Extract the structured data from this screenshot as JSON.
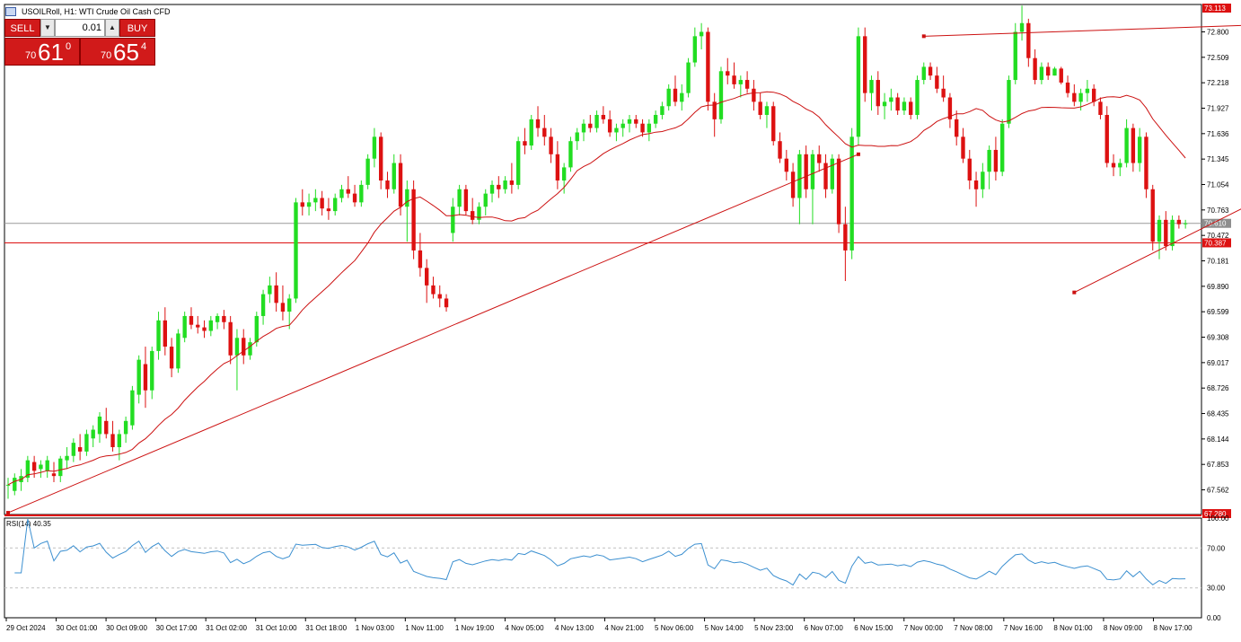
{
  "title": "USOILRoll, H1:  WTI Crude Oil Cash CFD",
  "trade_panel": {
    "sell_label": "SELL",
    "buy_label": "BUY",
    "lot": "0.01",
    "sell_price_prefix": "70",
    "sell_price_big": "61",
    "sell_price_sup": "0",
    "buy_price_prefix": "70",
    "buy_price_big": "65",
    "buy_price_sup": "4"
  },
  "price_axis_labels": [
    "72.800",
    "72.509",
    "72.218",
    "71.927",
    "71.636",
    "71.345",
    "71.054",
    "70.763",
    "70.472",
    "70.181",
    "69.890",
    "69.599",
    "69.308",
    "69.017",
    "68.726",
    "68.435",
    "68.144",
    "67.853",
    "67.562"
  ],
  "price_axis_top": "73.113",
  "price_axis_bottom": "67.280",
  "current_price": "70.610",
  "hline_price": "70.387",
  "rsi": {
    "label": "RSI(14) 40.35",
    "levels": [
      "100.00",
      "70.00",
      "30.00",
      "0.00"
    ]
  },
  "time_labels": [
    "29 Oct 2024",
    "30 Oct 01:00",
    "30 Oct 09:00",
    "30 Oct 17:00",
    "31 Oct 02:00",
    "31 Oct 10:00",
    "31 Oct 18:00",
    "1 Nov 03:00",
    "1 Nov 11:00",
    "1 Nov 19:00",
    "4 Nov 05:00",
    "4 Nov 13:00",
    "4 Nov 21:00",
    "5 Nov 06:00",
    "5 Nov 14:00",
    "5 Nov 23:00",
    "6 Nov 07:00",
    "6 Nov 15:00",
    "7 Nov 00:00",
    "7 Nov 08:00",
    "7 Nov 16:00",
    "8 Nov 01:00",
    "8 Nov 09:00",
    "8 Nov 17:00"
  ],
  "colors": {
    "bull": "#22dd22",
    "bear": "#dd1111",
    "ma": "#cc1111",
    "rsi_line": "#3b8fd0",
    "trend": "#cc1111",
    "axis": "#000000",
    "sell_buy_bg": "#d11a1a"
  },
  "chart_data": {
    "type": "candlestick",
    "symbol": "USOILRoll",
    "timeframe": "H1",
    "ylim": [
      67.28,
      73.113
    ],
    "candles": [
      [
        67.62,
        67.7,
        67.46,
        67.62
      ],
      [
        67.55,
        67.75,
        67.5,
        67.7
      ],
      [
        67.65,
        67.8,
        67.55,
        67.72
      ],
      [
        67.7,
        67.95,
        67.65,
        67.9
      ],
      [
        67.88,
        67.95,
        67.7,
        67.78
      ],
      [
        67.8,
        67.9,
        67.7,
        67.85
      ],
      [
        67.78,
        67.95,
        67.7,
        67.9
      ],
      [
        67.75,
        67.88,
        67.65,
        67.72
      ],
      [
        67.72,
        67.95,
        67.65,
        67.92
      ],
      [
        67.9,
        68.05,
        67.8,
        67.95
      ],
      [
        67.95,
        68.15,
        67.88,
        68.1
      ],
      [
        68.05,
        68.2,
        67.9,
        68.0
      ],
      [
        68.0,
        68.25,
        67.95,
        68.2
      ],
      [
        68.15,
        68.3,
        68.05,
        68.25
      ],
      [
        68.2,
        68.45,
        68.1,
        68.4
      ],
      [
        68.35,
        68.5,
        68.15,
        68.2
      ],
      [
        68.2,
        68.35,
        68.0,
        68.05
      ],
      [
        68.05,
        68.25,
        67.9,
        68.2
      ],
      [
        68.2,
        68.4,
        68.1,
        68.35
      ],
      [
        68.3,
        68.75,
        68.25,
        68.7
      ],
      [
        68.65,
        69.1,
        68.55,
        69.05
      ],
      [
        69.0,
        69.2,
        68.5,
        68.7
      ],
      [
        68.7,
        69.2,
        68.6,
        69.15
      ],
      [
        69.15,
        69.6,
        69.05,
        69.5
      ],
      [
        69.5,
        69.65,
        69.1,
        69.2
      ],
      [
        69.2,
        69.3,
        68.85,
        68.95
      ],
      [
        68.95,
        69.4,
        68.9,
        69.35
      ],
      [
        69.3,
        69.6,
        69.25,
        69.55
      ],
      [
        69.55,
        69.65,
        69.4,
        69.45
      ],
      [
        69.45,
        69.55,
        69.35,
        69.42
      ],
      [
        69.42,
        69.5,
        69.3,
        69.38
      ],
      [
        69.38,
        69.55,
        69.32,
        69.5
      ],
      [
        69.48,
        69.58,
        69.4,
        69.55
      ],
      [
        69.55,
        69.62,
        69.4,
        69.48
      ],
      [
        69.48,
        69.55,
        69.0,
        69.1
      ],
      [
        69.1,
        69.4,
        68.7,
        69.3
      ],
      [
        69.3,
        69.4,
        69.0,
        69.1
      ],
      [
        69.1,
        69.3,
        69.05,
        69.25
      ],
      [
        69.25,
        69.6,
        69.2,
        69.55
      ],
      [
        69.55,
        69.85,
        69.45,
        69.8
      ],
      [
        69.8,
        70.0,
        69.7,
        69.9
      ],
      [
        69.9,
        70.05,
        69.6,
        69.7
      ],
      [
        69.7,
        69.9,
        69.5,
        69.6
      ],
      [
        69.6,
        69.8,
        69.4,
        69.75
      ],
      [
        69.75,
        70.9,
        69.7,
        70.85
      ],
      [
        70.85,
        71.0,
        70.7,
        70.8
      ],
      [
        70.8,
        70.95,
        70.7,
        70.85
      ],
      [
        70.85,
        71.0,
        70.75,
        70.9
      ],
      [
        70.9,
        70.98,
        70.7,
        70.78
      ],
      [
        70.78,
        70.9,
        70.65,
        70.75
      ],
      [
        70.75,
        70.95,
        70.7,
        70.9
      ],
      [
        70.9,
        71.05,
        70.85,
        71.0
      ],
      [
        71.0,
        71.15,
        70.9,
        70.95
      ],
      [
        70.95,
        71.05,
        70.8,
        70.85
      ],
      [
        70.85,
        71.1,
        70.8,
        71.05
      ],
      [
        71.05,
        71.4,
        71.0,
        71.35
      ],
      [
        71.35,
        71.7,
        71.25,
        71.6
      ],
      [
        71.6,
        71.65,
        71.0,
        71.1
      ],
      [
        71.1,
        71.2,
        70.9,
        71.0
      ],
      [
        71.0,
        71.4,
        70.95,
        71.3
      ],
      [
        71.3,
        71.4,
        70.7,
        70.8
      ],
      [
        70.8,
        71.1,
        70.4,
        71.0
      ],
      [
        71.0,
        71.1,
        70.2,
        70.3
      ],
      [
        70.3,
        70.5,
        70.0,
        70.1
      ],
      [
        70.1,
        70.2,
        69.7,
        69.9
      ],
      [
        69.9,
        70.0,
        69.75,
        69.8
      ],
      [
        69.8,
        69.9,
        69.65,
        69.75
      ],
      [
        69.75,
        69.8,
        69.6,
        69.65
      ],
      [
        70.5,
        70.9,
        70.4,
        70.8
      ],
      [
        70.8,
        71.05,
        70.7,
        71.0
      ],
      [
        71.0,
        71.05,
        70.7,
        70.75
      ],
      [
        70.75,
        70.9,
        70.6,
        70.65
      ],
      [
        70.65,
        70.85,
        70.6,
        70.8
      ],
      [
        70.8,
        71.0,
        70.7,
        70.95
      ],
      [
        70.95,
        71.1,
        70.85,
        71.05
      ],
      [
        71.05,
        71.15,
        70.9,
        71.0
      ],
      [
        71.0,
        71.15,
        70.95,
        71.1
      ],
      [
        71.1,
        71.3,
        70.95,
        71.05
      ],
      [
        71.05,
        71.6,
        71.0,
        71.55
      ],
      [
        71.55,
        71.7,
        71.4,
        71.5
      ],
      [
        71.5,
        71.85,
        71.45,
        71.8
      ],
      [
        71.8,
        71.95,
        71.6,
        71.7
      ],
      [
        71.7,
        71.85,
        71.5,
        71.6
      ],
      [
        71.6,
        71.7,
        71.3,
        71.4
      ],
      [
        71.4,
        71.55,
        71.0,
        71.1
      ],
      [
        71.1,
        71.3,
        70.95,
        71.25
      ],
      [
        71.25,
        71.6,
        71.2,
        71.55
      ],
      [
        71.55,
        71.7,
        71.45,
        71.65
      ],
      [
        71.65,
        71.8,
        71.55,
        71.75
      ],
      [
        71.75,
        71.85,
        71.65,
        71.7
      ],
      [
        71.7,
        71.9,
        71.65,
        71.85
      ],
      [
        71.85,
        71.95,
        71.75,
        71.8
      ],
      [
        71.8,
        71.9,
        71.6,
        71.65
      ],
      [
        71.65,
        71.75,
        71.55,
        71.7
      ],
      [
        71.7,
        71.8,
        71.6,
        71.75
      ],
      [
        71.75,
        71.85,
        71.65,
        71.8
      ],
      [
        71.8,
        71.85,
        71.7,
        71.75
      ],
      [
        71.75,
        71.8,
        71.6,
        71.65
      ],
      [
        71.65,
        71.8,
        71.55,
        71.75
      ],
      [
        71.75,
        71.9,
        71.7,
        71.85
      ],
      [
        71.85,
        72.0,
        71.8,
        71.95
      ],
      [
        71.95,
        72.2,
        71.9,
        72.15
      ],
      [
        72.15,
        72.3,
        71.95,
        72.0
      ],
      [
        72.0,
        72.2,
        71.9,
        72.1
      ],
      [
        72.1,
        72.5,
        72.05,
        72.45
      ],
      [
        72.45,
        72.85,
        72.4,
        72.75
      ],
      [
        72.75,
        72.9,
        72.6,
        72.8
      ],
      [
        72.8,
        72.85,
        71.9,
        72.0
      ],
      [
        72.0,
        72.1,
        71.6,
        71.8
      ],
      [
        71.8,
        72.4,
        71.75,
        72.35
      ],
      [
        72.35,
        72.5,
        72.2,
        72.3
      ],
      [
        72.3,
        72.45,
        72.15,
        72.2
      ],
      [
        72.2,
        72.3,
        72.05,
        72.25
      ],
      [
        72.25,
        72.35,
        72.1,
        72.15
      ],
      [
        72.15,
        72.25,
        71.9,
        72.0
      ],
      [
        72.0,
        72.1,
        71.8,
        71.85
      ],
      [
        71.85,
        72.0,
        71.7,
        71.95
      ],
      [
        71.95,
        72.0,
        71.5,
        71.55
      ],
      [
        71.55,
        71.65,
        71.3,
        71.35
      ],
      [
        71.35,
        71.45,
        71.1,
        71.2
      ],
      [
        71.2,
        71.3,
        70.8,
        70.9
      ],
      [
        70.9,
        71.45,
        70.6,
        71.4
      ],
      [
        71.4,
        71.5,
        70.9,
        71.0
      ],
      [
        71.0,
        71.45,
        70.6,
        71.4
      ],
      [
        71.4,
        71.5,
        71.2,
        71.3
      ],
      [
        71.3,
        71.4,
        70.9,
        71.0
      ],
      [
        71.0,
        71.4,
        70.95,
        71.35
      ],
      [
        71.35,
        71.4,
        70.5,
        70.6
      ],
      [
        70.6,
        70.8,
        69.95,
        70.3
      ],
      [
        70.3,
        71.7,
        70.2,
        71.6
      ],
      [
        71.6,
        72.85,
        71.5,
        72.75
      ],
      [
        72.75,
        72.85,
        72.0,
        72.1
      ],
      [
        72.1,
        72.3,
        71.9,
        72.25
      ],
      [
        72.25,
        72.35,
        71.85,
        71.95
      ],
      [
        71.95,
        72.1,
        71.8,
        72.0
      ],
      [
        72.0,
        72.15,
        71.9,
        72.05
      ],
      [
        72.05,
        72.1,
        71.85,
        71.9
      ],
      [
        71.9,
        72.05,
        71.85,
        72.0
      ],
      [
        72.0,
        72.05,
        71.8,
        71.85
      ],
      [
        71.85,
        72.3,
        71.8,
        72.25
      ],
      [
        72.25,
        72.45,
        72.2,
        72.4
      ],
      [
        72.4,
        72.45,
        72.25,
        72.3
      ],
      [
        72.3,
        72.4,
        72.1,
        72.15
      ],
      [
        72.15,
        72.3,
        72.0,
        72.05
      ],
      [
        72.05,
        72.1,
        71.7,
        71.8
      ],
      [
        71.8,
        71.9,
        71.5,
        71.6
      ],
      [
        71.6,
        71.7,
        71.3,
        71.35
      ],
      [
        71.35,
        71.45,
        71.0,
        71.1
      ],
      [
        71.1,
        71.2,
        70.8,
        71.0
      ],
      [
        71.0,
        71.3,
        70.9,
        71.2
      ],
      [
        71.2,
        71.5,
        71.0,
        71.45
      ],
      [
        71.45,
        71.6,
        71.1,
        71.2
      ],
      [
        71.2,
        71.8,
        71.15,
        71.75
      ],
      [
        71.75,
        72.3,
        71.7,
        72.25
      ],
      [
        72.25,
        72.9,
        72.2,
        72.8
      ],
      [
        72.8,
        73.1,
        72.7,
        72.9
      ],
      [
        72.9,
        72.95,
        72.4,
        72.5
      ],
      [
        72.5,
        72.6,
        72.2,
        72.25
      ],
      [
        72.25,
        72.45,
        72.2,
        72.4
      ],
      [
        72.4,
        72.45,
        72.25,
        72.3
      ],
      [
        72.3,
        72.4,
        72.3,
        72.38
      ],
      [
        72.38,
        72.4,
        72.2,
        72.22
      ],
      [
        72.22,
        72.3,
        72.05,
        72.1
      ],
      [
        72.1,
        72.2,
        71.95,
        72.0
      ],
      [
        72.0,
        72.15,
        71.9,
        72.1
      ],
      [
        72.1,
        72.25,
        72.0,
        72.15
      ],
      [
        72.15,
        72.2,
        71.95,
        72.0
      ],
      [
        72.0,
        72.05,
        71.8,
        71.85
      ],
      [
        71.85,
        71.95,
        71.25,
        71.3
      ],
      [
        71.3,
        71.4,
        71.15,
        71.25
      ],
      [
        71.25,
        71.35,
        71.15,
        71.3
      ],
      [
        71.3,
        71.8,
        71.25,
        71.7
      ],
      [
        71.7,
        71.75,
        71.2,
        71.3
      ],
      [
        71.3,
        71.7,
        71.2,
        71.6
      ],
      [
        71.6,
        71.65,
        70.9,
        71.0
      ],
      [
        71.0,
        71.05,
        70.3,
        70.4
      ],
      [
        70.4,
        70.7,
        70.2,
        70.65
      ],
      [
        70.65,
        70.75,
        70.3,
        70.35
      ],
      [
        70.35,
        70.7,
        70.3,
        70.65
      ],
      [
        70.65,
        70.7,
        70.55,
        70.6
      ],
      [
        70.6,
        70.65,
        70.55,
        70.61
      ]
    ],
    "ma_period": 20,
    "trendlines": [
      {
        "from": [
          67.3,
          0
        ],
        "to": [
          71.4,
          130
        ]
      },
      {
        "from": [
          72.75,
          140
        ],
        "to": [
          72.98,
          231
        ]
      },
      {
        "from": [
          69.82,
          163
        ],
        "to": [
          72.4,
          232
        ]
      }
    ],
    "rsi_period": 14,
    "rsi_last": 40.35
  }
}
